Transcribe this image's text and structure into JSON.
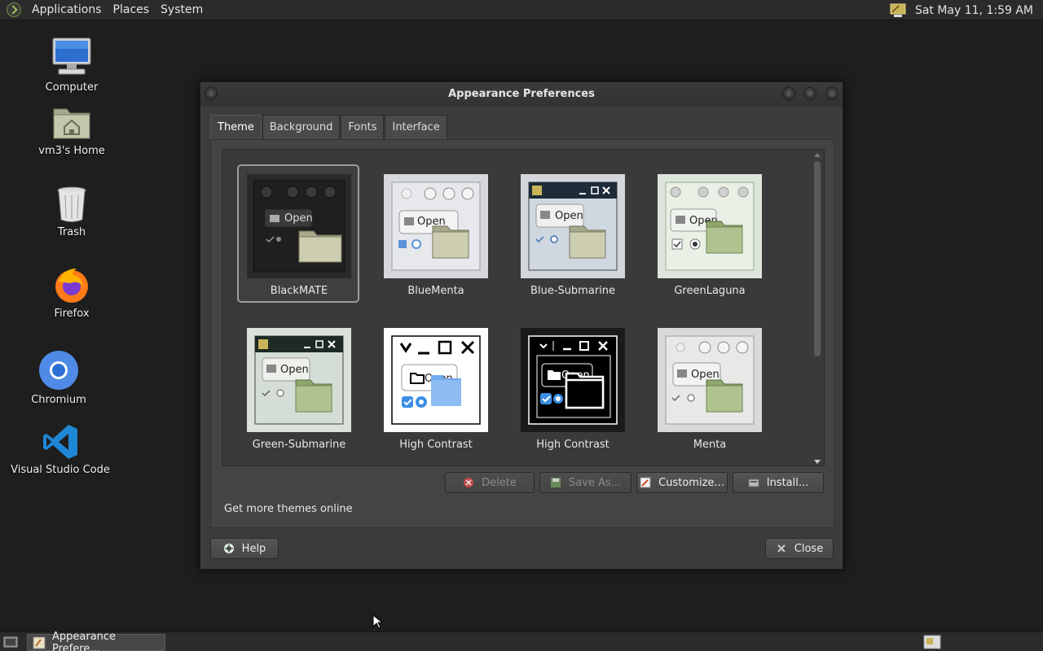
{
  "top_panel": {
    "menus": [
      "Applications",
      "Places",
      "System"
    ],
    "clock": "Sat May 11,  1:59 AM"
  },
  "desktop": {
    "icons": [
      {
        "label": "Computer"
      },
      {
        "label": "vm3's Home"
      },
      {
        "label": "Trash"
      },
      {
        "label": "Firefox"
      },
      {
        "label": "Chromium"
      },
      {
        "label": "Visual Studio Code"
      }
    ]
  },
  "window": {
    "title": "Appearance Preferences",
    "tabs": [
      "Theme",
      "Background",
      "Fonts",
      "Interface"
    ],
    "active_tab": "Theme",
    "themes": [
      {
        "name": "BlackMATE",
        "selected": true
      },
      {
        "name": "BlueMenta"
      },
      {
        "name": "Blue-Submarine"
      },
      {
        "name": "GreenLaguna"
      },
      {
        "name": "Green-Submarine"
      },
      {
        "name": "High Contrast"
      },
      {
        "name": "High Contrast"
      },
      {
        "name": "Menta"
      }
    ],
    "thumb_open_label": "Open",
    "buttons": {
      "delete": "Delete",
      "save_as": "Save As...",
      "customize": "Customize...",
      "install": "Install...",
      "help": "Help",
      "close": "Close"
    },
    "get_more": "Get more themes online"
  },
  "taskbar": {
    "item": "Appearance Prefere..."
  },
  "colors": {
    "desktop_bg": "#1e1e1e",
    "panel_bg": "#2b2b2b",
    "window_bg": "#3c3c3c",
    "accent_green": "#9fc15a"
  }
}
